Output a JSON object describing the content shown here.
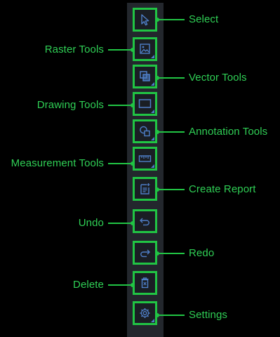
{
  "colors": {
    "background": "#000000",
    "toolbar": "#23272d",
    "highlight": "#21c444",
    "label": "#2fcf55",
    "icon": "#4f7fc8"
  },
  "toolbar": {
    "tools": [
      {
        "key": "select",
        "icon": "cursor-arrow-icon",
        "label": "Select",
        "side": "right",
        "has_submenu": false
      },
      {
        "key": "raster",
        "icon": "image-icon",
        "label": "Raster Tools",
        "side": "left",
        "has_submenu": true
      },
      {
        "key": "vector",
        "icon": "overlapping-squares-icon",
        "label": "Vector Tools",
        "side": "right",
        "has_submenu": true
      },
      {
        "key": "drawing",
        "icon": "rectangle-icon",
        "label": "Drawing Tools",
        "side": "left",
        "has_submenu": true
      },
      {
        "key": "annotation",
        "icon": "shapes-icon",
        "label": "Annotation Tools",
        "side": "right",
        "has_submenu": true
      },
      {
        "key": "measurement",
        "icon": "ruler-icon",
        "label": "Measurement Tools",
        "side": "left",
        "has_submenu": true
      },
      {
        "key": "report",
        "icon": "report-icon",
        "label": "Create Report",
        "side": "right",
        "has_submenu": false
      },
      {
        "key": "undo",
        "icon": "undo-icon",
        "label": "Undo",
        "side": "left",
        "has_submenu": false
      },
      {
        "key": "redo",
        "icon": "redo-icon",
        "label": "Redo",
        "side": "right",
        "has_submenu": false
      },
      {
        "key": "delete",
        "icon": "trash-icon",
        "label": "Delete",
        "side": "left",
        "has_submenu": false
      },
      {
        "key": "settings",
        "icon": "gear-icon",
        "label": "Settings",
        "side": "right",
        "has_submenu": true
      }
    ]
  }
}
